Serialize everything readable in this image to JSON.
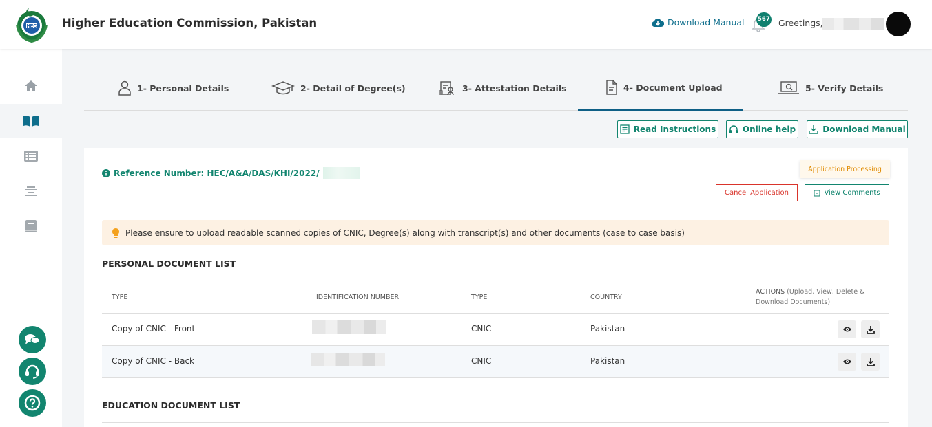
{
  "header": {
    "title": "Higher Education Commission, Pakistan",
    "download_manual": "Download Manual",
    "notification_count": "567",
    "greeting": "Greetings,"
  },
  "sidebar": {
    "items": [
      {
        "icon": "home-icon"
      },
      {
        "icon": "book-icon",
        "active": true
      },
      {
        "icon": "list-icon"
      },
      {
        "icon": "align-center-icon"
      },
      {
        "icon": "notebook-icon"
      }
    ],
    "floating": [
      {
        "icon": "chat-icon"
      },
      {
        "icon": "headset-icon"
      },
      {
        "icon": "question-icon"
      }
    ]
  },
  "stepper": {
    "steps": [
      {
        "label": "1- Personal Details",
        "icon": "user-icon"
      },
      {
        "label": "2- Detail of Degree(s)",
        "icon": "graduation-cap-icon"
      },
      {
        "label": "3- Attestation Details",
        "icon": "attestation-icon"
      },
      {
        "label": "4- Document Upload",
        "icon": "document-icon",
        "active": true
      },
      {
        "label": "5- Verify Details",
        "icon": "laptop-icon"
      }
    ]
  },
  "actions": {
    "read_instructions": "Read Instructions",
    "online_help": "Online help",
    "download_manual": "Download Manual"
  },
  "application": {
    "reference_label": "Reference Number: HEC/A&A/DAS/KHI/2022/",
    "status": "Application Processing",
    "cancel_label": "Cancel Application",
    "comments_label": "View Comments",
    "notice": "Please ensure to upload readable scanned copies of CNIC, Degree(s) along with transcript(s) and other documents (case to case basis)"
  },
  "personal_documents": {
    "title": "PERSONAL DOCUMENT LIST",
    "columns": {
      "type": "TYPE",
      "identification": "IDENTIFICATION NUMBER",
      "doc_type": "TYPE",
      "country": "COUNTRY",
      "actions": "ACTIONS",
      "actions_note": "(Upload, View, Delete &",
      "actions_note2": "Download Documents)"
    },
    "rows": [
      {
        "type": "Copy of CNIC - Front",
        "doc_type": "CNIC",
        "country": "Pakistan"
      },
      {
        "type": "Copy of CNIC - Back",
        "doc_type": "CNIC",
        "country": "Pakistan"
      }
    ]
  },
  "education_documents": {
    "title": "EDUCATION DOCUMENT LIST"
  },
  "colors": {
    "accent": "#12856f",
    "stepper_active": "#0e5f86",
    "danger": "#d9342b",
    "warning": "#e08a00"
  }
}
